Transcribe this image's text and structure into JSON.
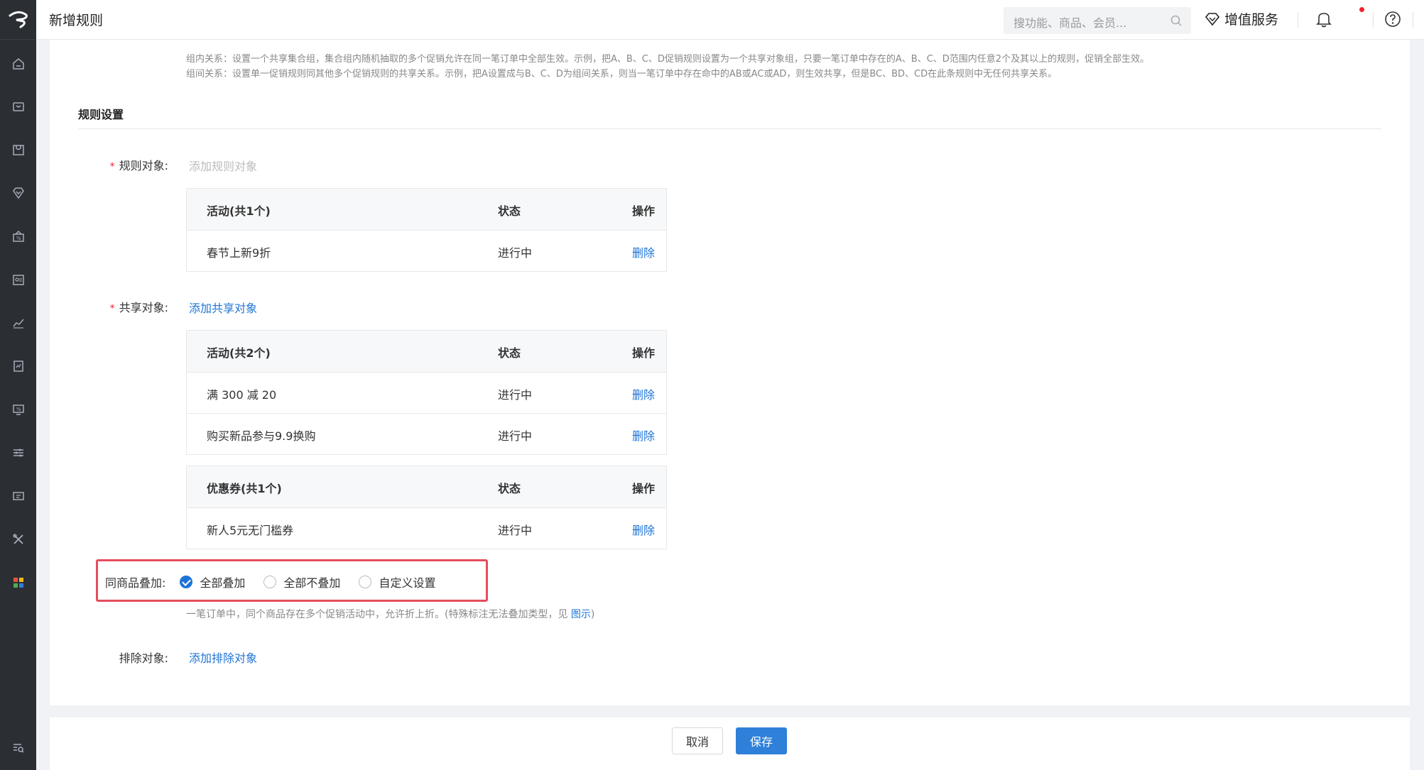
{
  "header": {
    "title": "新增规则",
    "search_placeholder": "搜功能、商品、会员...",
    "value_added_label": "增值服务"
  },
  "notes": {
    "line1": "组内关系：设置一个共享集合组，集合组内随机抽取的多个促销允许在同一笔订单中全部生效。示例，把A、B、C、D促销规则设置为一个共享对象组，只要一笔订单中存在的A、B、C、D范围内任意2个及其以上的规则，促销全部生效。",
    "line2": "组间关系：设置单一促销规则同其他多个促销规则的共享关系。示例，把A设置成与B、C、D为组间关系，则当一笔订单中存在命中的AB或AC或AD，则生效共享，但是BC、BD、CD在此条规则中无任何共享关系。"
  },
  "section": {
    "title": "规则设置"
  },
  "rule_target": {
    "label": "规则对象:",
    "add_link": "添加规则对象",
    "table": {
      "headers": [
        "活动(共1个)",
        "状态",
        "操作"
      ],
      "rows": [
        {
          "name": "春节上新9折",
          "status": "进行中",
          "action": "删除"
        }
      ]
    }
  },
  "share_target": {
    "label": "共享对象:",
    "add_link": "添加共享对象",
    "activity_table": {
      "headers": [
        "活动(共2个)",
        "状态",
        "操作"
      ],
      "rows": [
        {
          "name": "满 300 减 20",
          "status": "进行中",
          "action": "删除"
        },
        {
          "name": "购买新品参与9.9换购",
          "status": "进行中",
          "action": "删除"
        }
      ]
    },
    "coupon_table": {
      "headers": [
        "优惠券(共1个)",
        "状态",
        "操作"
      ],
      "rows": [
        {
          "name": "新人5元无门槛券",
          "status": "进行中",
          "action": "删除"
        }
      ]
    }
  },
  "stacking": {
    "label": "同商品叠加:",
    "options": [
      "全部叠加",
      "全部不叠加",
      "自定义设置"
    ],
    "selected": "全部叠加",
    "hint_text": "一笔订单中，同个商品存在多个促销活动中，允许折上折。(特殊标注无法叠加类型，见",
    "hint_link": "图示",
    "hint_end": ")"
  },
  "exclude_target": {
    "label": "排除对象:",
    "add_link": "添加排除对象"
  },
  "footer": {
    "cancel_label": "取消",
    "save_label": "保存"
  },
  "colors": {
    "sidebar_bg": "#2b2f33",
    "accent_blue": "#1e74d6",
    "highlight_red": "#e54d5e",
    "required_red": "#f5222d"
  },
  "icons": {
    "sidebar": [
      "logo-icon",
      "home-icon",
      "wallet-icon",
      "store-icon",
      "diamond-icon",
      "marketing-icon",
      "member-card-icon",
      "analytics-icon",
      "report-icon",
      "finance-icon",
      "settings-sliders-icon",
      "message-icon",
      "tools-icon",
      "apps-icon",
      "search-list-icon"
    ],
    "topbar": [
      "search-icon",
      "diamond-icon",
      "bell-icon",
      "help-icon",
      "user-icon"
    ]
  }
}
